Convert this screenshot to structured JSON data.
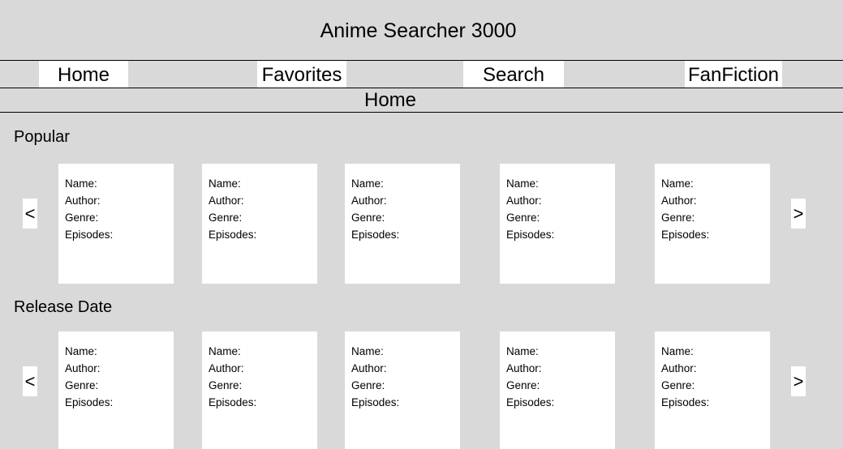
{
  "app": {
    "title": "Anime Searcher 3000"
  },
  "nav": {
    "items": [
      {
        "label": "Home"
      },
      {
        "label": "Favorites"
      },
      {
        "label": "Search"
      },
      {
        "label": "FanFiction"
      }
    ]
  },
  "page": {
    "heading": "Home"
  },
  "card_fields": {
    "name": "Name:",
    "author": "Author:",
    "genre": "Genre:",
    "episodes": "Episodes:"
  },
  "sections": [
    {
      "title": "Popular",
      "prev_label": "<",
      "next_label": ">",
      "card_count": 5
    },
    {
      "title": "Release Date",
      "prev_label": "<",
      "next_label": ">",
      "card_count": 5
    }
  ],
  "colors": {
    "background": "#d9d9d9",
    "surface": "#ffffff",
    "text": "#000000",
    "divider": "#000000"
  }
}
